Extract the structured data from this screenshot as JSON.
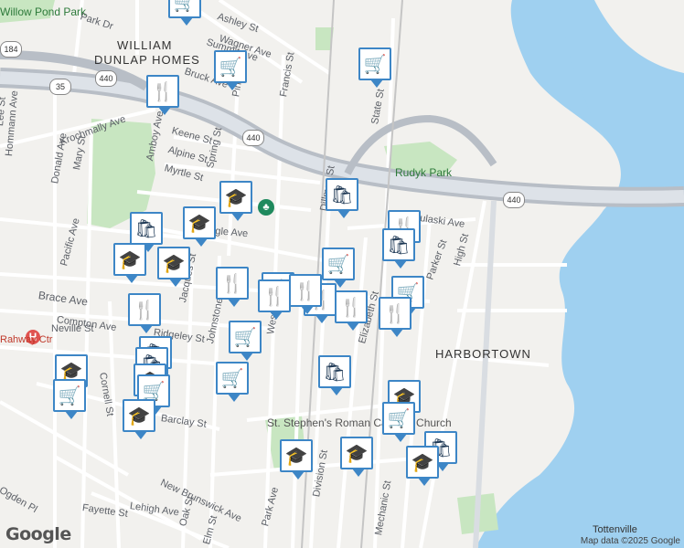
{
  "map": {
    "areas": [
      "WILLIAM",
      "DUNLAP HOMES",
      "HARBORTOWN"
    ],
    "parks": [
      "Rudyk Park",
      "Willow Pond Park"
    ],
    "streets": [
      "Ashley St",
      "Wagner Ave",
      "Summit Ave",
      "Bruck Ave",
      "Pine St",
      "Francis St",
      "Keene St",
      "Alpine St",
      "Myrtle St",
      "Spring St",
      "Amboy Ave",
      "Krochmally Ave",
      "Mary St",
      "Donald Ave",
      "Hommann Ave",
      "Lee St",
      "Pacific Ave",
      "Brace Ave",
      "Compton Ave",
      "Neville St",
      "Cornell St",
      "Ogden Pl",
      "Jacques St",
      "Johnstone St",
      "West St",
      "Dillman St",
      "Eagle Ave",
      "Pulaski Ave",
      "Parker St",
      "High St",
      "Elizabeth St",
      "Division St",
      "Mechanic St",
      "State St",
      "Park Ave",
      "Oak St",
      "Elm St",
      "Barclay St",
      "Lehigh Ave",
      "Ridgeley St",
      "New Brunswick Ave",
      "Fayette St",
      "Park Dr"
    ],
    "places": [
      "St. Stephen's Roman Catholic Church",
      "Tottenville"
    ],
    "route_shields": [
      "440",
      "184",
      "35",
      "440",
      "440"
    ],
    "hospital_label": "Rahway Ctr",
    "water_color": "#9fd0f0",
    "park_color": "#c8e6c1",
    "pin_color": "#3d86c6"
  },
  "markers": [
    {
      "type": "shopping-cart",
      "icon": "🛒"
    },
    {
      "type": "shopping-cart",
      "icon": "🛒"
    },
    {
      "type": "restaurant",
      "icon": "🍴"
    },
    {
      "type": "shopping-cart",
      "icon": "🛒"
    },
    {
      "type": "shopping-bag",
      "icon": "🛍"
    },
    {
      "type": "school",
      "icon": "🎓"
    },
    {
      "type": "school",
      "icon": "🎓"
    },
    {
      "type": "shopping-bag",
      "icon": "🛍"
    },
    {
      "type": "school",
      "icon": "🎓"
    },
    {
      "type": "school",
      "icon": "🎓"
    },
    {
      "type": "restaurant",
      "icon": "🍴"
    },
    {
      "type": "shopping-bag",
      "icon": "🛍"
    },
    {
      "type": "restaurant",
      "icon": "🍴"
    },
    {
      "type": "shopping-cart",
      "icon": "🛒"
    },
    {
      "type": "restaurant",
      "icon": "🍴"
    },
    {
      "type": "restaurant",
      "icon": "🍴"
    },
    {
      "type": "restaurant",
      "icon": "🍴"
    },
    {
      "type": "restaurant",
      "icon": "🍴"
    },
    {
      "type": "shopping-cart",
      "icon": "🛒"
    },
    {
      "type": "restaurant",
      "icon": "🍴"
    },
    {
      "type": "restaurant",
      "icon": "🍴"
    },
    {
      "type": "restaurant",
      "icon": "🍴"
    },
    {
      "type": "shopping-bag",
      "icon": "🛍"
    },
    {
      "type": "shopping-cart",
      "icon": "🛒"
    },
    {
      "type": "school",
      "icon": "🎓"
    },
    {
      "type": "shopping-bag",
      "icon": "🛍"
    },
    {
      "type": "shopping-cart",
      "icon": "🛒"
    },
    {
      "type": "school",
      "icon": "🎓"
    },
    {
      "type": "shopping-cart",
      "icon": "🛒"
    },
    {
      "type": "shopping-cart",
      "icon": "🛒"
    },
    {
      "type": "shopping-bag",
      "icon": "🛍"
    },
    {
      "type": "school",
      "icon": "🎓"
    },
    {
      "type": "school",
      "icon": "🎓"
    },
    {
      "type": "shopping-cart",
      "icon": "🛒"
    },
    {
      "type": "school",
      "icon": "🎓"
    },
    {
      "type": "school",
      "icon": "🎓"
    },
    {
      "type": "shopping-bag",
      "icon": "🛍"
    },
    {
      "type": "school",
      "icon": "🎓"
    }
  ],
  "footer": {
    "logo": "Google",
    "attribution": "Map data ©2025 Google"
  }
}
